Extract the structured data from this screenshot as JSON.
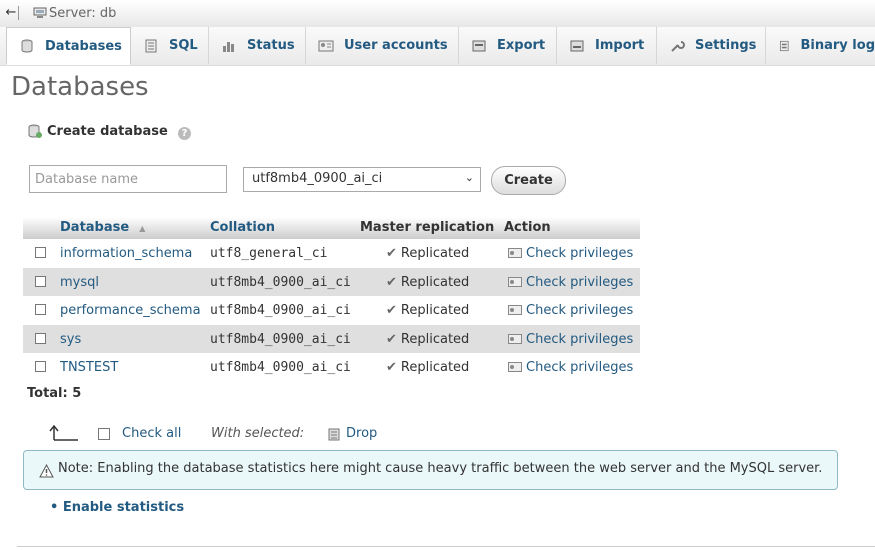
{
  "topbar": {
    "back": "←",
    "server": "Server: db"
  },
  "tabs": [
    {
      "label": "Databases",
      "icon": "database-icon",
      "active": true
    },
    {
      "label": "SQL",
      "icon": "sql-icon"
    },
    {
      "label": "Status",
      "icon": "status-icon"
    },
    {
      "label": "User accounts",
      "icon": "users-icon"
    },
    {
      "label": "Export",
      "icon": "export-icon"
    },
    {
      "label": "Import",
      "icon": "import-icon"
    },
    {
      "label": "Settings",
      "icon": "wrench-icon"
    },
    {
      "label": "Binary log",
      "icon": "binlog-icon"
    }
  ],
  "page": {
    "title": "Databases"
  },
  "create": {
    "heading": "Create database",
    "help": "?",
    "name_placeholder": "Database name",
    "name_value": "",
    "collation": "utf8mb4_0900_ai_ci",
    "button": "Create"
  },
  "table": {
    "headers": {
      "database": "Database",
      "collation": "Collation",
      "replication": "Master replication",
      "action": "Action"
    },
    "rows": [
      {
        "name": "information_schema",
        "collation": "utf8_general_ci",
        "replication": "Replicated",
        "action": "Check privileges"
      },
      {
        "name": "mysql",
        "collation": "utf8mb4_0900_ai_ci",
        "replication": "Replicated",
        "action": "Check privileges"
      },
      {
        "name": "performance_schema",
        "collation": "utf8mb4_0900_ai_ci",
        "replication": "Replicated",
        "action": "Check privileges"
      },
      {
        "name": "sys",
        "collation": "utf8mb4_0900_ai_ci",
        "replication": "Replicated",
        "action": "Check privileges"
      },
      {
        "name": "TNSTEST",
        "collation": "utf8mb4_0900_ai_ci",
        "replication": "Replicated",
        "action": "Check privileges"
      }
    ],
    "total": "Total: 5"
  },
  "bulk": {
    "check_all": "Check all",
    "with_selected": "With selected:",
    "drop": "Drop"
  },
  "notice": {
    "text": "Note: Enabling the database statistics here might cause heavy traffic between the web server and the MySQL server."
  },
  "enable_stats": "Enable statistics",
  "colors": {
    "link": "#235a81",
    "notice_bg": "#ebf8fa",
    "row_alt": "#dfdfdf"
  }
}
